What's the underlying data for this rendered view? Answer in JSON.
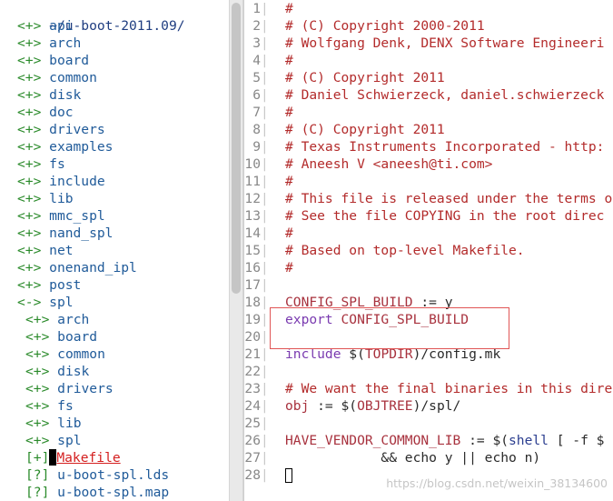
{
  "tree": {
    "path": "~/u-boot-2011.09/",
    "items": [
      {
        "marker": "<+>",
        "name": "api",
        "indent": 0
      },
      {
        "marker": "<+>",
        "name": "arch",
        "indent": 0
      },
      {
        "marker": "<+>",
        "name": "board",
        "indent": 0
      },
      {
        "marker": "<+>",
        "name": "common",
        "indent": 0
      },
      {
        "marker": "<+>",
        "name": "disk",
        "indent": 0
      },
      {
        "marker": "<+>",
        "name": "doc",
        "indent": 0
      },
      {
        "marker": "<+>",
        "name": "drivers",
        "indent": 0
      },
      {
        "marker": "<+>",
        "name": "examples",
        "indent": 0
      },
      {
        "marker": "<+>",
        "name": "fs",
        "indent": 0
      },
      {
        "marker": "<+>",
        "name": "include",
        "indent": 0
      },
      {
        "marker": "<+>",
        "name": "lib",
        "indent": 0
      },
      {
        "marker": "<+>",
        "name": "mmc_spl",
        "indent": 0
      },
      {
        "marker": "<+>",
        "name": "nand_spl",
        "indent": 0
      },
      {
        "marker": "<+>",
        "name": "net",
        "indent": 0
      },
      {
        "marker": "<+>",
        "name": "onenand_ipl",
        "indent": 0
      },
      {
        "marker": "<+>",
        "name": "post",
        "indent": 0
      },
      {
        "marker": "<->",
        "name": "spl",
        "indent": 0
      },
      {
        "marker": "<+>",
        "name": "arch",
        "indent": 1
      },
      {
        "marker": "<+>",
        "name": "board",
        "indent": 1
      },
      {
        "marker": "<+>",
        "name": "common",
        "indent": 1
      },
      {
        "marker": "<+>",
        "name": "disk",
        "indent": 1
      },
      {
        "marker": "<+>",
        "name": "drivers",
        "indent": 1
      },
      {
        "marker": "<+>",
        "name": "fs",
        "indent": 1
      },
      {
        "marker": "<+>",
        "name": "lib",
        "indent": 1
      },
      {
        "marker": "<+>",
        "name": "spl",
        "indent": 1
      },
      {
        "marker": "[+]",
        "name": "Makefile",
        "indent": 1,
        "selected": true
      },
      {
        "marker": "[?]",
        "name": "u-boot-spl.lds",
        "indent": 1
      },
      {
        "marker": "[?]",
        "name": "u-boot-spl.map",
        "indent": 1
      }
    ]
  },
  "editor": {
    "lines": [
      {
        "n": "1",
        "spans": [
          {
            "t": "#",
            "c": "comment"
          }
        ]
      },
      {
        "n": "2",
        "spans": [
          {
            "t": "# (C) Copyright 2000-2011",
            "c": "comment"
          }
        ]
      },
      {
        "n": "3",
        "spans": [
          {
            "t": "# Wolfgang Denk, DENX Software Engineeri",
            "c": "comment"
          }
        ]
      },
      {
        "n": "4",
        "spans": [
          {
            "t": "#",
            "c": "comment"
          }
        ]
      },
      {
        "n": "5",
        "spans": [
          {
            "t": "# (C) Copyright 2011",
            "c": "comment"
          }
        ]
      },
      {
        "n": "6",
        "spans": [
          {
            "t": "# Daniel Schwierzeck, daniel.schwierzeck",
            "c": "comment"
          }
        ]
      },
      {
        "n": "7",
        "spans": [
          {
            "t": "#",
            "c": "comment"
          }
        ]
      },
      {
        "n": "8",
        "spans": [
          {
            "t": "# (C) Copyright 2011",
            "c": "comment"
          }
        ]
      },
      {
        "n": "9",
        "spans": [
          {
            "t": "# Texas Instruments Incorporated - http:",
            "c": "comment"
          }
        ]
      },
      {
        "n": "10",
        "spans": [
          {
            "t": "# Aneesh V <aneesh@ti.com>",
            "c": "comment"
          }
        ]
      },
      {
        "n": "11",
        "spans": [
          {
            "t": "#",
            "c": "comment"
          }
        ]
      },
      {
        "n": "12",
        "spans": [
          {
            "t": "# This file is released under the terms o",
            "c": "comment"
          }
        ]
      },
      {
        "n": "13",
        "spans": [
          {
            "t": "# See the file COPYING in the root direc",
            "c": "comment"
          }
        ]
      },
      {
        "n": "14",
        "spans": [
          {
            "t": "#",
            "c": "comment"
          }
        ]
      },
      {
        "n": "15",
        "spans": [
          {
            "t": "# Based on top-level Makefile.",
            "c": "comment"
          }
        ]
      },
      {
        "n": "16",
        "spans": [
          {
            "t": "#",
            "c": "comment"
          }
        ]
      },
      {
        "n": "17",
        "spans": []
      },
      {
        "n": "18",
        "spans": [
          {
            "t": "CONFIG_SPL_BUILD",
            "c": "var"
          },
          {
            "t": " := y",
            "c": "text"
          }
        ]
      },
      {
        "n": "19",
        "spans": [
          {
            "t": "export",
            "c": "kw"
          },
          {
            "t": " CONFIG_SPL_BUILD",
            "c": "var"
          }
        ]
      },
      {
        "n": "20",
        "spans": []
      },
      {
        "n": "21",
        "spans": [
          {
            "t": "include",
            "c": "kw"
          },
          {
            "t": " $(",
            "c": "text"
          },
          {
            "t": "TOPDIR",
            "c": "var"
          },
          {
            "t": ")/config.mk",
            "c": "text"
          }
        ]
      },
      {
        "n": "22",
        "spans": []
      },
      {
        "n": "23",
        "spans": [
          {
            "t": "# We want the final binaries in this dire",
            "c": "comment"
          }
        ]
      },
      {
        "n": "24",
        "spans": [
          {
            "t": "obj",
            "c": "var"
          },
          {
            "t": " := $(",
            "c": "text"
          },
          {
            "t": "OBJTREE",
            "c": "var"
          },
          {
            "t": ")/spl/",
            "c": "text"
          }
        ]
      },
      {
        "n": "25",
        "spans": []
      },
      {
        "n": "26",
        "spans": [
          {
            "t": "HAVE_VENDOR_COMMON_LIB",
            "c": "var"
          },
          {
            "t": " := $(",
            "c": "text"
          },
          {
            "t": "shell",
            "c": "cmd"
          },
          {
            "t": " [ -f $",
            "c": "text"
          }
        ]
      },
      {
        "n": "27",
        "spans": [
          {
            "t": "            && echo y || echo n)",
            "c": "text"
          }
        ]
      },
      {
        "n": "28",
        "spans": [],
        "cursor": true
      }
    ]
  },
  "watermark": "https://blog.csdn.net/weixin_38134600",
  "colors": {
    "comment": "#b32b2b",
    "keyword": "#7a3bb0",
    "variable": "#a8323e",
    "tree_marker": "#2a8a2a",
    "tree_dir": "#1f5a99",
    "selected_file": "#d41f1f",
    "highlight_box": "#e05555"
  }
}
